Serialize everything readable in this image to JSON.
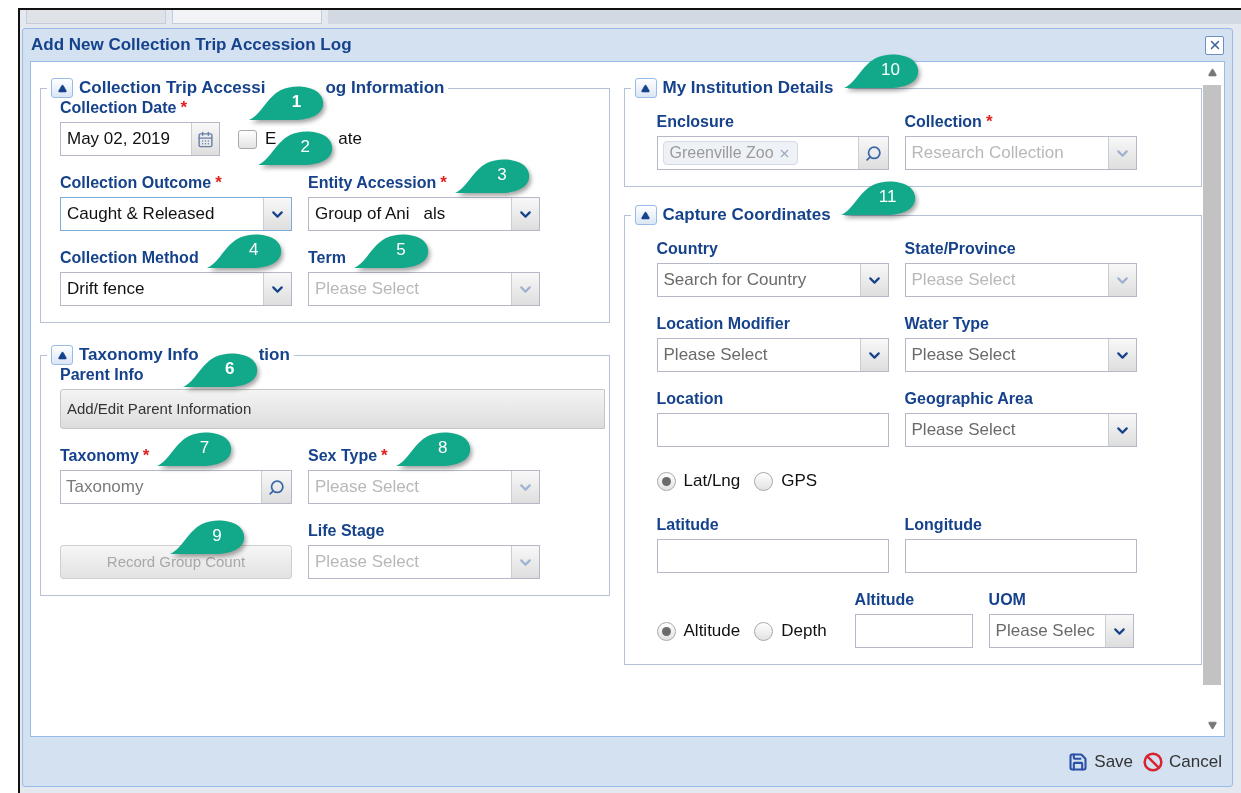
{
  "dialog": {
    "title": "Add New Collection Trip Accession Log"
  },
  "left_sections": [
    {
      "title_parts": [
        "Collection Trip Accessi",
        "og Information"
      ],
      "gap_callout": "1",
      "rows": [
        [
          {
            "kind": "date",
            "label": "Collection Date",
            "required_mark": "*",
            "value": "May 02, 2019"
          },
          {
            "kind": "checkbox",
            "label_parts": [
              "E",
              "ate"
            ],
            "checked": false,
            "gap_callout": "2"
          }
        ],
        [
          {
            "kind": "select",
            "label": "Collection Outcome",
            "required_mark": "*",
            "value": "Caught & Released",
            "focused": true
          },
          {
            "kind": "select",
            "label": "Entity Accession",
            "required_mark": "*",
            "value_parts": [
              "Group of Ani",
              "als"
            ],
            "callout": "3"
          }
        ],
        [
          {
            "kind": "select",
            "label": "Collection Method",
            "value": "Drift fence",
            "callout": "4"
          },
          {
            "kind": "select",
            "label": "Term",
            "placeholder": "Please Select",
            "disabled": true,
            "callout": "5"
          }
        ]
      ]
    },
    {
      "title_parts": [
        "Taxonomy Info",
        "tion"
      ],
      "gap_callout": "6",
      "rows": [
        [
          {
            "kind": "wide-button",
            "label": "Parent Info",
            "button_label": "Add/Edit Parent Information"
          }
        ],
        [
          {
            "kind": "search",
            "label": "Taxonomy",
            "required_mark": "*",
            "placeholder": "Taxonomy",
            "callout": "7"
          },
          {
            "kind": "select",
            "label": "Sex Type",
            "required_mark": "*",
            "placeholder": "Please Select",
            "disabled": true,
            "callout": "8"
          }
        ],
        [
          {
            "kind": "button",
            "button_label": "Record Group Count",
            "disabled": true,
            "callout": "9"
          },
          {
            "kind": "select",
            "label": "Life Stage",
            "placeholder": "Please Select",
            "disabled": true
          }
        ]
      ]
    }
  ],
  "right_sections": [
    {
      "title_parts": [
        "My Institution Details"
      ],
      "callout": "10",
      "rows": [
        [
          {
            "kind": "tags",
            "label": "Enclosure",
            "tags": [
              "Greenville Zoo"
            ],
            "disabled": true
          },
          {
            "kind": "select",
            "label": "Collection",
            "required_mark": "*",
            "value": "Research Collection",
            "disabled": true
          }
        ]
      ]
    },
    {
      "title_parts": [
        "Capture Coordinates"
      ],
      "callout": "11",
      "rows": [
        [
          {
            "kind": "select",
            "label": "Country",
            "placeholder": "Search for Country"
          },
          {
            "kind": "select",
            "label": "State/Province",
            "placeholder": "Please Select",
            "disabled": true
          }
        ],
        [
          {
            "kind": "select",
            "label": "Location Modifier",
            "placeholder": "Please Select"
          },
          {
            "kind": "select",
            "label": "Water Type",
            "placeholder": "Please Select"
          }
        ],
        [
          {
            "kind": "text",
            "label": "Location"
          },
          {
            "kind": "select",
            "label": "Geographic Area",
            "placeholder": "Please Select"
          }
        ],
        [
          {
            "kind": "radio",
            "options": [
              {
                "label": "Lat/Lng",
                "selected": true
              },
              {
                "label": "GPS",
                "selected": false
              }
            ]
          }
        ],
        [
          {
            "kind": "text",
            "label": "Latitude"
          },
          {
            "kind": "text",
            "label": "Longitude"
          }
        ],
        [
          {
            "kind": "radio",
            "options": [
              {
                "label": "Altitude",
                "selected": true
              },
              {
                "label": "Depth",
                "selected": false
              }
            ]
          },
          {
            "kind": "text",
            "label": "Altitude"
          },
          {
            "kind": "select",
            "label": "UOM",
            "placeholder": "Please Selec"
          }
        ]
      ]
    }
  ],
  "footer_buttons": [
    {
      "kind": "save",
      "label": "Save"
    },
    {
      "kind": "cancel",
      "label": "Cancel"
    }
  ]
}
